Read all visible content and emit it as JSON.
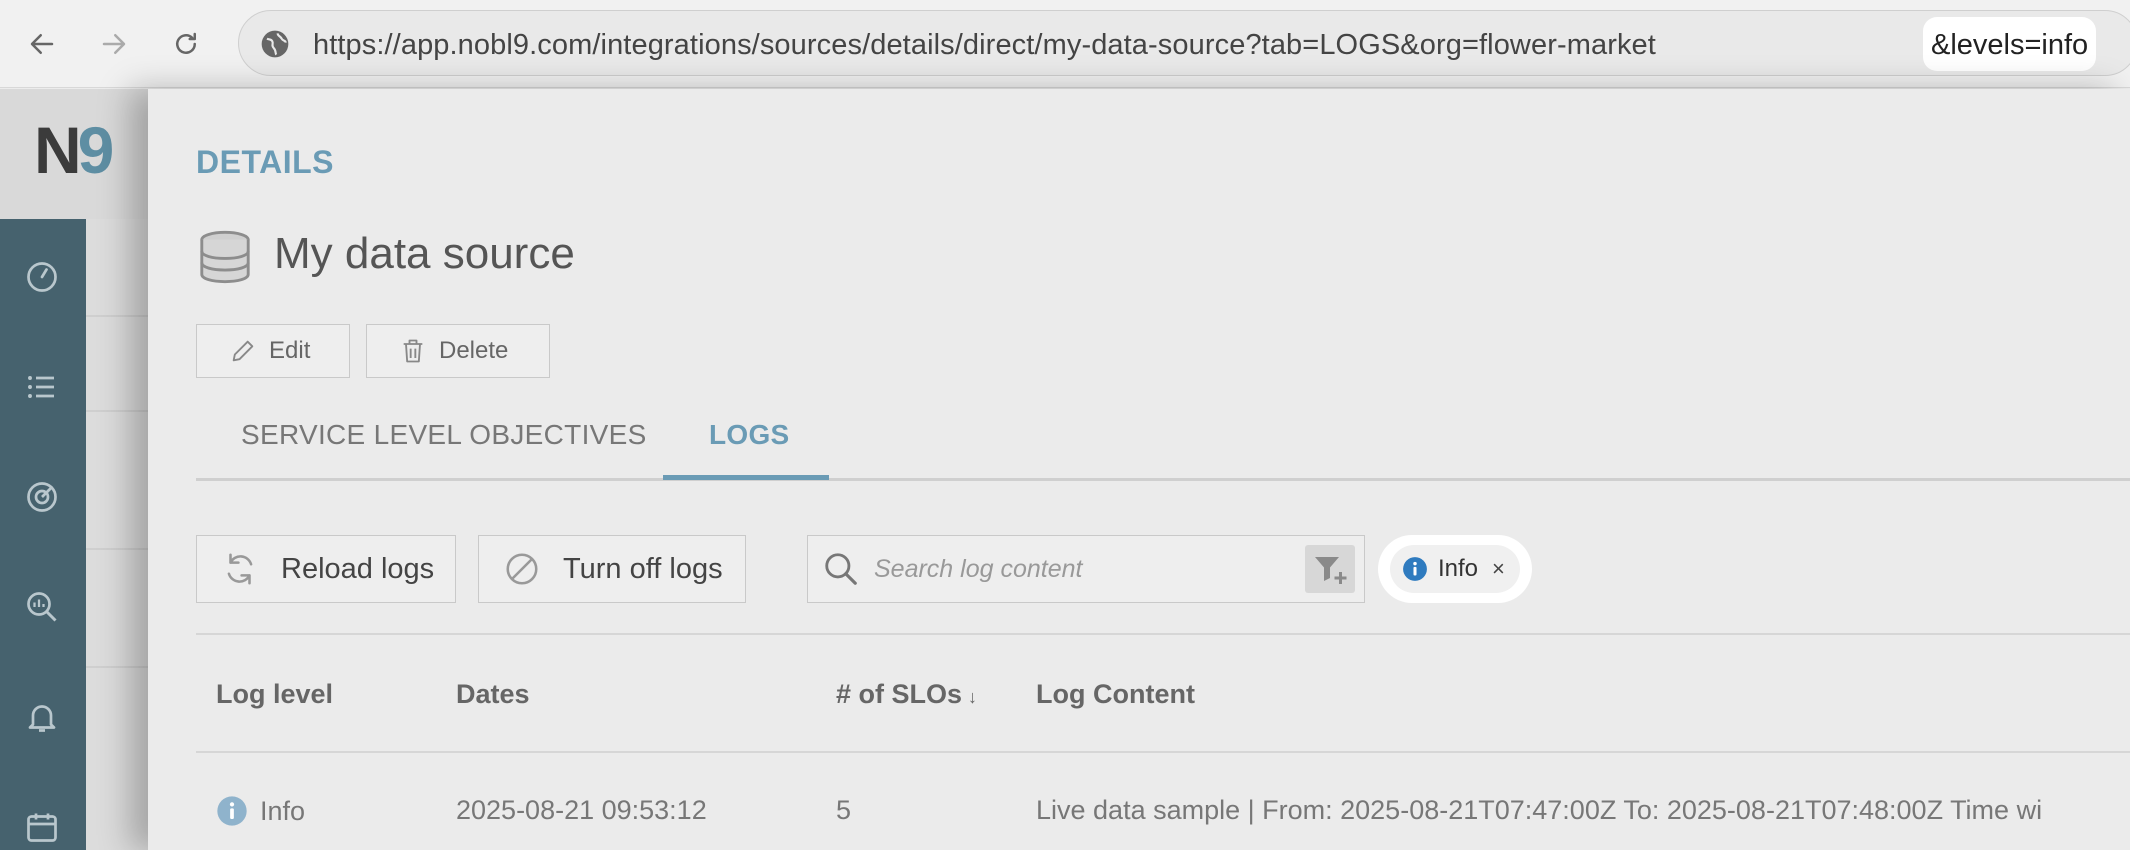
{
  "browser": {
    "url_main": "https://app.nobl9.com/integrations/sources/details/direct/my-data-source?tab=LOGS&org=flower-market",
    "url_highlight": "&levels=info"
  },
  "app": {
    "logo_n": "N",
    "logo_9": "9"
  },
  "panel": {
    "section_label": "DETAILS",
    "title": "My data source",
    "edit_label": "Edit",
    "delete_label": "Delete",
    "tabs": [
      {
        "label": "SERVICE LEVEL OBJECTIVES",
        "active": false
      },
      {
        "label": "LOGS",
        "active": true
      }
    ],
    "reload_label": "Reload logs",
    "turn_off_label": "Turn off logs",
    "search_placeholder": "Search log content",
    "filter_chip": "Info",
    "filter_chip_close": "×",
    "table": {
      "headers": [
        "Log level",
        "Dates",
        "# of SLOs",
        "Log Content"
      ],
      "sort_indicator": "↓",
      "rows": [
        {
          "level": "Info",
          "date": "2025-08-21 09:53:12",
          "slos": "5",
          "content": "Live data sample | From: 2025-08-21T07:47:00Z To: 2025-08-21T07:48:00Z Time wi"
        }
      ]
    }
  },
  "colors": {
    "accent": "#6a9bb5",
    "sidebar": "#46626e",
    "info_icon": "#2f7bbf"
  }
}
